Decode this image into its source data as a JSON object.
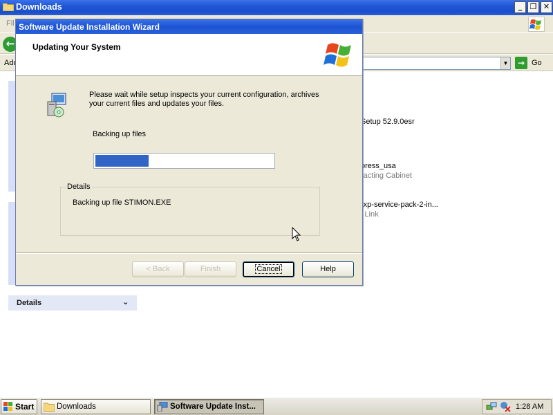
{
  "explorer": {
    "title": "Downloads",
    "menu_first_letters": "Fil",
    "address_label": "Add",
    "go_label": "Go",
    "files": [
      {
        "name": "Setup 52.9.0esr",
        "sub": ""
      },
      {
        "name": "press_usa",
        "sub": "racting Cabinet"
      },
      {
        "name": "-xp-service-pack-2-in...",
        "sub": "l Link"
      }
    ],
    "details_label": "Details"
  },
  "wizard": {
    "title": "Software Update Installation Wizard",
    "header_title": "Updating Your System",
    "description": "Please wait while setup inspects your current configuration, archives your current files and updates your files.",
    "status": "Backing up files",
    "progress": 0.3,
    "details_legend": "Details",
    "details_text": "Backing up file STIMON.EXE",
    "buttons": {
      "back": "< Back",
      "finish": "Finish",
      "cancel": "Cancel",
      "help": "Help"
    }
  },
  "taskbar": {
    "start_label": "Start",
    "tasks": [
      {
        "label": "Downloads",
        "icon": "folder-icon"
      },
      {
        "label": "Software Update Inst...",
        "icon": "setup-icon"
      }
    ],
    "clock": "1:28 AM"
  },
  "colors": {
    "titlebar": "#1f56d6",
    "dialog_bg": "#ece9d8",
    "progress_fill": "#3165c5"
  }
}
